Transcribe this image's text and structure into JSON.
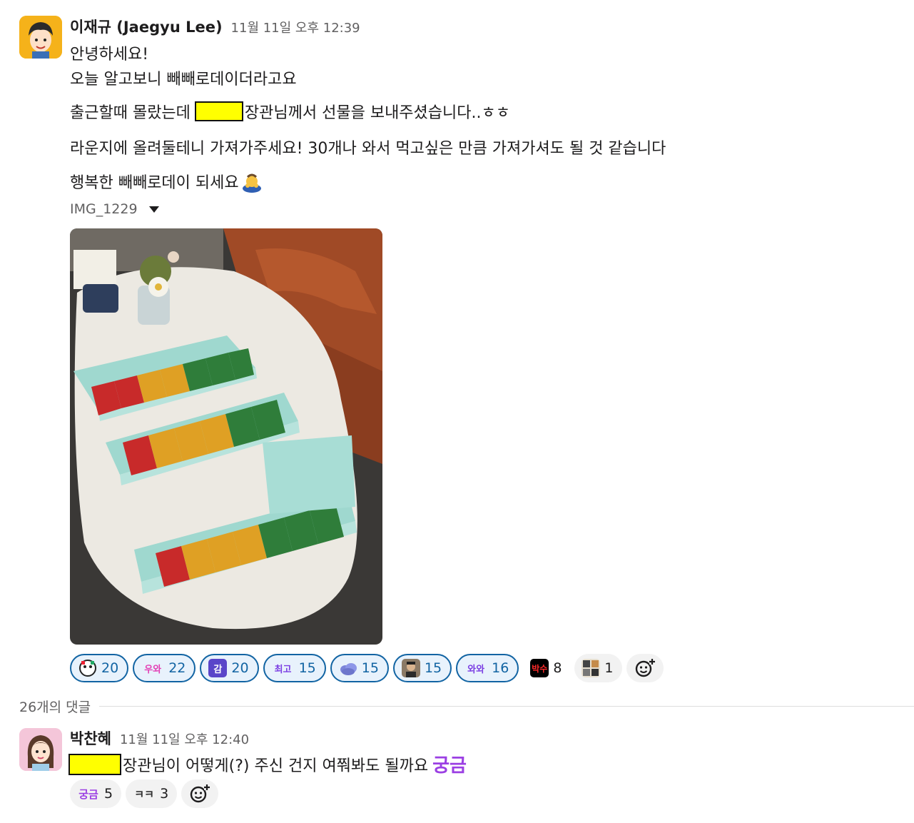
{
  "message": {
    "author": "이재규 (Jaegyu Lee)",
    "time": "11월 11일 오후 12:39",
    "lines": {
      "l1": "안녕하세요!",
      "l2": "오늘 알고보니 빼빼로데이더라고요",
      "l3_before": "출근할때 몰랐는데",
      "l3_after": "장관님께서 선물을 보내주셨습니다..ㅎㅎ",
      "l4": "라운지에 올려둘테니 가져가주세요! 30개나 와서 먹고싶은 만큼 가져가셔도 될 것 같습니다",
      "l5": "행복한 빼빼로데이 되세요"
    },
    "attachment_name": "IMG_1229",
    "reactions": [
      {
        "emoji": "face-icon",
        "count": "20"
      },
      {
        "emoji": "우와",
        "count": "22"
      },
      {
        "emoji": "감",
        "count": "20"
      },
      {
        "emoji": "최고",
        "count": "15"
      },
      {
        "emoji": "cloud-icon",
        "count": "15"
      },
      {
        "emoji": "person-photo-icon",
        "count": "15"
      },
      {
        "emoji": "와와",
        "count": "16"
      },
      {
        "emoji": "박수",
        "count": "8"
      },
      {
        "emoji": "sticker-icon",
        "count": "1"
      }
    ]
  },
  "thread": {
    "replies_label": "26개의 댓글"
  },
  "reply": {
    "author": "박찬혜",
    "time": "11월 11일 오후 12:40",
    "text_after": "장관님이 어떻게(?) 주신 건지 여쭤봐도 될까요",
    "inline_emoji": "궁금",
    "reactions": [
      {
        "emoji": "궁금",
        "count": "5"
      },
      {
        "emoji": "ㅋㅋ",
        "count": "3"
      }
    ]
  },
  "colors": {
    "accent": "#1264a3",
    "redaction": "#ffff00",
    "purple_text": "#9b3fe3"
  }
}
